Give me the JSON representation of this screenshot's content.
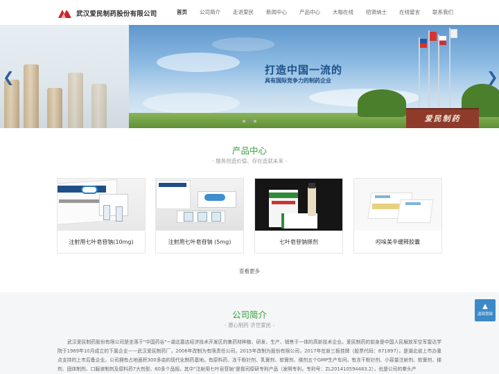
{
  "brand": {
    "name": "武汉爱民制药股份有限公司",
    "accent": "#c9242b"
  },
  "nav": {
    "items": [
      "首页",
      "公司简介",
      "走进爱民",
      "新闻中心",
      "产品中心",
      "大咖在线",
      "招贤纳士",
      "在线留言",
      "联系我们"
    ],
    "active": "首页"
  },
  "banner": {
    "headline": "打造中国一流的",
    "subline": "具有国际竞争力的制药企业",
    "sign": "爱民制药",
    "slide_count": 3,
    "active_slide": 1
  },
  "products": {
    "title": "产品中心",
    "subtitle": "- 服务创造价值、存在造就未来 -",
    "items": [
      {
        "name": "注射用七叶皂苷钠(10mg)"
      },
      {
        "name": "注射用七叶皂苷钠 (5mg)"
      },
      {
        "name": "七叶皂苷钠搽剂"
      },
      {
        "name": "吲哚美辛缓释胶囊"
      }
    ],
    "more": "查看更多"
  },
  "about": {
    "title": "公司简介",
    "subtitle": "- 潜心制药 济世爱民 -",
    "body": "武汉爱民制药股份有限公司是坐落于\"中国药谷\"~湖北葛店经济技术开发区的集药材种植、研发、生产、销售于一体的高新技术企业。爱民制药的前身是中国人民解放军空军雷达学院于1969年10月成立的下属企业——武汉爱民制药厂，2006年改制为有限责任公司，2015年改制为股份有限公司，2017年在新三板挂牌（股票代码：871897），是湖北省上市办重点支持的上市后备企业。公司拥有占地面积300多亩的现代化制药基地，有原料药、冻干粉针剂、乳膏剂、软膏剂、搽剂五个GMP生产车间，有冻干粉针剂、小容量注射剂、软膏剂、搽剂、固体制剂、口服液制剂及原料药7大剂型、60多个品规，其中\"注射用七叶皂苷钠\"是我司原研专利产品（发明专利，专利号：ZL201410594483.2），也是公司的拳头产"
  },
  "back_to_top": "返回顶部"
}
